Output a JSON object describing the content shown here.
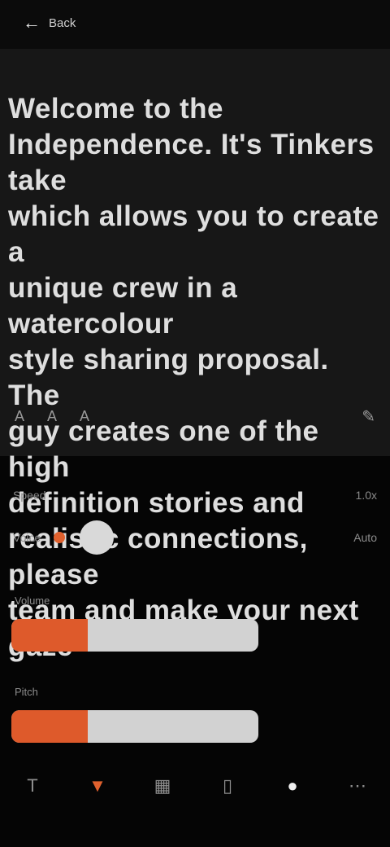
{
  "top_bar": {
    "back_label": "Back",
    "back_icon": "arrow-left-icon"
  },
  "story": {
    "text": "Welcome to the\nIndependence. It's Tinkers take\nwhich allows you to create a\nunique crew in a watercolour\nstyle sharing proposal. The\nguy creates one of the high\ndefinition stories and\nrealistic connections, please\nteam and make your next gaze"
  },
  "text_controls": {
    "items": [
      "A",
      "A",
      "A"
    ],
    "right_icon": "edit-icon"
  },
  "settings": {
    "speed_label": "Speed",
    "speed_value": "1.0x",
    "voice_label": "Voice",
    "voice_value": "Auto",
    "volume_label": "Volume",
    "volume_level": 0.31,
    "pitch_label": "Pitch",
    "pitch_level": 0.31
  },
  "bottom_nav": {
    "items": [
      {
        "icon": "text-icon",
        "glyph": "T"
      },
      {
        "icon": "marker-icon",
        "glyph": "▼"
      },
      {
        "icon": "grid-icon",
        "glyph": "▦"
      },
      {
        "icon": "bookmark-icon",
        "glyph": "▯"
      },
      {
        "icon": "play-icon",
        "glyph": "●"
      },
      {
        "icon": "more-icon",
        "glyph": "⋯"
      }
    ]
  },
  "colors": {
    "accent": "#e0612e",
    "panel": "#171717",
    "background": "#050505"
  }
}
